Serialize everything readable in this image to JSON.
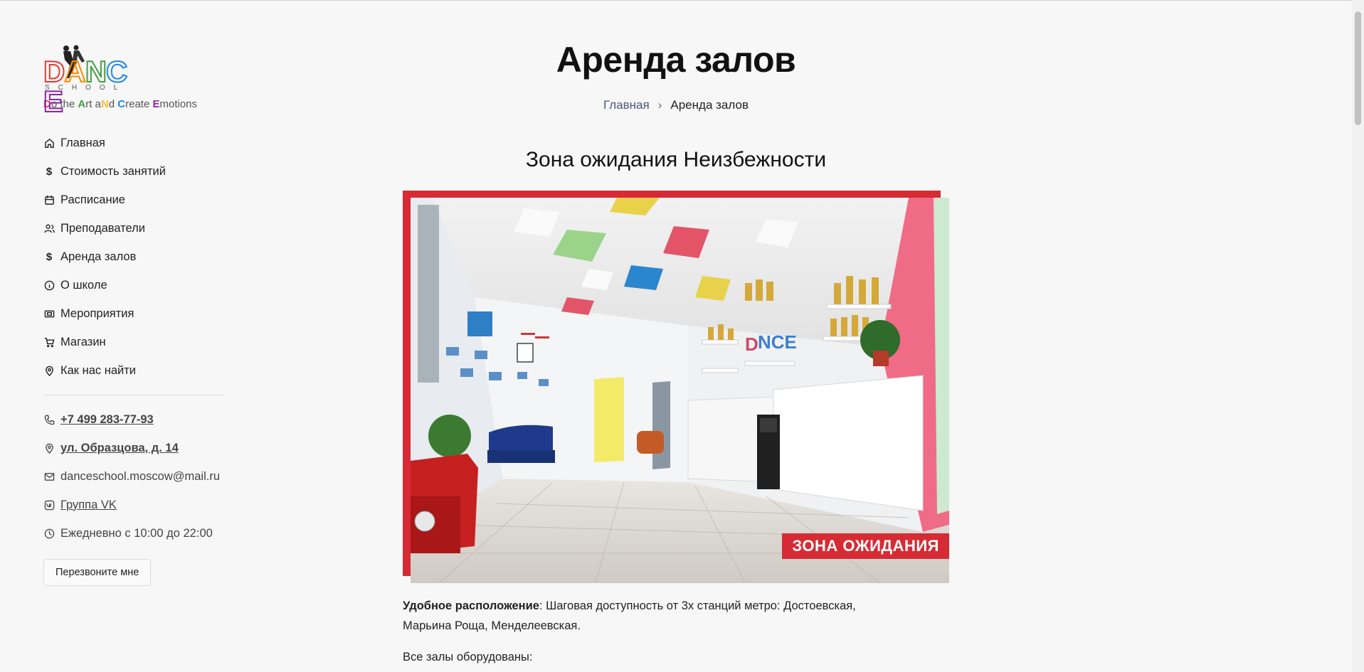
{
  "brand": {
    "logo_letters": [
      "D",
      "A",
      "N",
      "C",
      "E"
    ],
    "logo_sub": "SCHOOL",
    "tagline_parts": [
      {
        "t": "D",
        "bold": true,
        "color": "#e53935"
      },
      {
        "t": "o the ",
        "bold": false,
        "color": "#555555"
      },
      {
        "t": "A",
        "bold": true,
        "color": "#43a047"
      },
      {
        "t": "rt a",
        "bold": false,
        "color": "#555555"
      },
      {
        "t": "N",
        "bold": true,
        "color": "#fbc02d"
      },
      {
        "t": "d ",
        "bold": false,
        "color": "#555555"
      },
      {
        "t": "C",
        "bold": true,
        "color": "#1e88e5"
      },
      {
        "t": "reate ",
        "bold": false,
        "color": "#555555"
      },
      {
        "t": "E",
        "bold": true,
        "color": "#8e24aa"
      },
      {
        "t": "motions",
        "bold": false,
        "color": "#555555"
      }
    ],
    "colors": [
      "#e53935",
      "#fb8c00",
      "#43a047",
      "#1e88e5",
      "#8e24aa"
    ]
  },
  "nav": [
    {
      "label": "Главная",
      "icon": "home-icon"
    },
    {
      "label": "Стоимость занятий",
      "icon": "dollar-icon"
    },
    {
      "label": "Расписание",
      "icon": "calendar-icon"
    },
    {
      "label": "Преподаватели",
      "icon": "users-icon"
    },
    {
      "label": "Аренда залов",
      "icon": "dollar-icon"
    },
    {
      "label": "О школе",
      "icon": "info-icon"
    },
    {
      "label": "Мероприятия",
      "icon": "ticket-icon"
    },
    {
      "label": "Магазин",
      "icon": "cart-icon"
    },
    {
      "label": "Как нас найти",
      "icon": "map-pin-icon"
    }
  ],
  "contacts": {
    "phone": "+7 499 283-77-93",
    "address": "ул. Образцова, д. 14",
    "email": "danceschool.moscow@mail.ru",
    "vk": "Группа VK",
    "hours": "Ежедневно с 10:00 до 22:00"
  },
  "callback_button": "Перезвоните мне",
  "page": {
    "title": "Аренда залов",
    "breadcrumb_home": "Главная",
    "breadcrumb_sep": "›",
    "breadcrumb_current": "Аренда залов",
    "section_title": "Зона ожидания Неизбежности",
    "photo_badge": "ЗОНА ОЖИДАНИЯ",
    "p1_bold": "Удобное расположение",
    "p1_text": ": Шаговая доступность от 3х станций метро: Достоевская, Марьина Роща, Менделеевская.",
    "p2_text": "Все залы оборудованы:"
  }
}
